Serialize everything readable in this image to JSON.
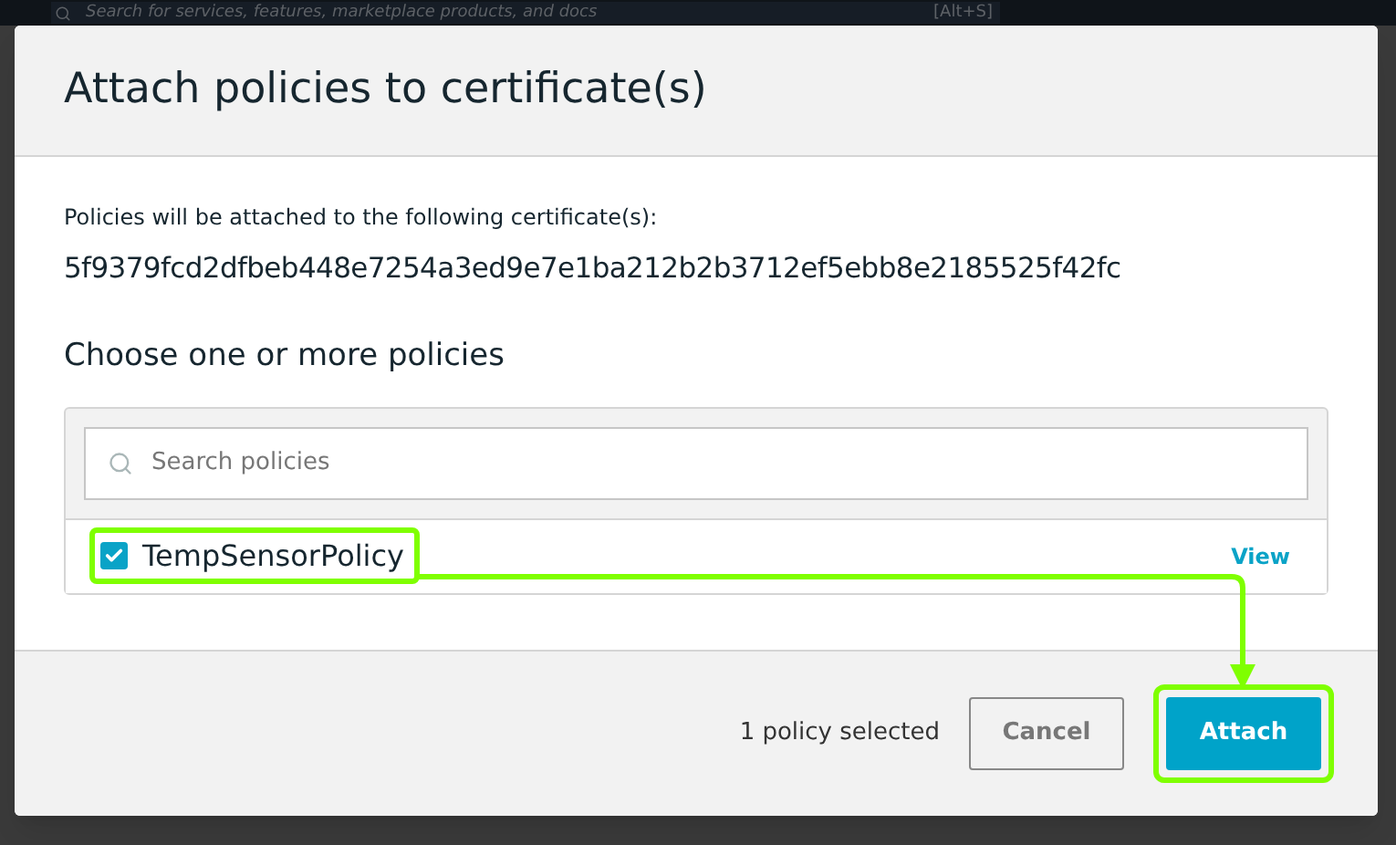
{
  "backdrop": {
    "search_placeholder": "Search for services, features, marketplace products, and docs",
    "shortcut": "[Alt+S]"
  },
  "dialog": {
    "title": "Attach policies to certificate(s)",
    "intro": "Policies will be attached to the following certificate(s):",
    "certificate_id": "5f9379fcd2dfbeb448e7254a3ed9e7e1ba212b2b3712ef5ebb8e2185525f42fc",
    "section_title": "Choose one or more policies",
    "search": {
      "placeholder": "Search policies"
    },
    "policies": [
      {
        "name": "TempSensorPolicy",
        "checked": true,
        "link": "View"
      }
    ],
    "footer": {
      "summary": "1 policy selected",
      "buttons": [
        {
          "label": "Cancel",
          "kind": "secondary"
        },
        {
          "label": "Attach",
          "kind": "primary"
        }
      ]
    }
  }
}
